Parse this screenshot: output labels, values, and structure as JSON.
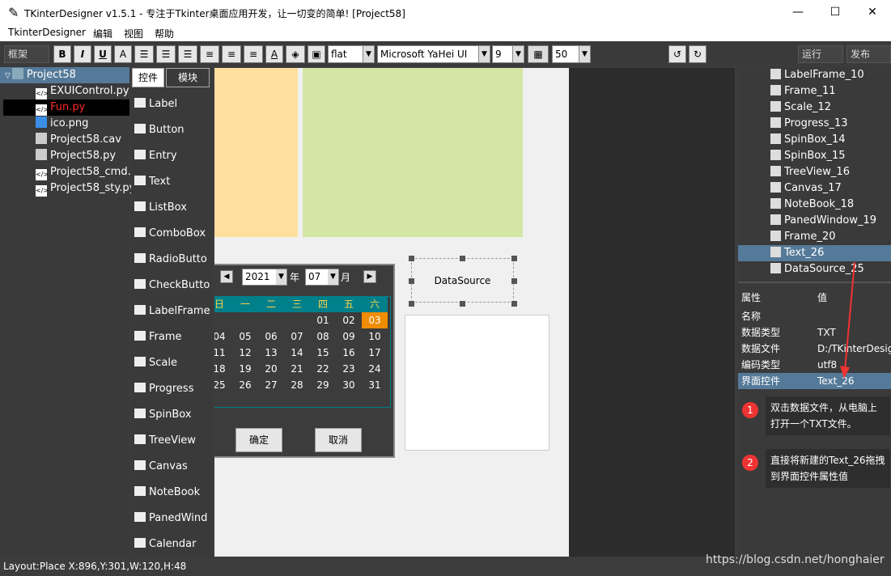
{
  "window": {
    "title": "TKinterDesigner v1.5.1 - 专注于Tkinter桌面应用开发，让一切变的简单!   [Project58]",
    "min": "—",
    "max": "☐",
    "close": "✕"
  },
  "menu": [
    "TkinterDesigner",
    "编辑",
    "视图",
    "帮助"
  ],
  "toolbar": {
    "frame_label": "框架",
    "bold": "B",
    "italic": "I",
    "underline": "U",
    "textA": "A",
    "relief": "flat",
    "font": "Microsoft YaHei UI",
    "size": "9",
    "alpha": "50",
    "run": "运行",
    "publish": "发布"
  },
  "files": [
    {
      "name": "Project58",
      "color": "#ffffff"
    },
    {
      "name": "EXUIControl.py",
      "color": "#ffffff"
    },
    {
      "name": "Fun.py",
      "color": "#ff2a2a"
    },
    {
      "name": "ico.png",
      "color": "#ffffff"
    },
    {
      "name": "Project58.cav",
      "color": "#ffffff"
    },
    {
      "name": "Project58.py",
      "color": "#ffffff"
    },
    {
      "name": "Project58_cmd.py",
      "color": "#ffffff"
    },
    {
      "name": "Project58_sty.py",
      "color": "#ffffff"
    }
  ],
  "palette": {
    "tab_controls": "控件",
    "tab_modules": "模块",
    "items": [
      "Label",
      "Button",
      "Entry",
      "Text",
      "ListBox",
      "ComboBox",
      "RadioButto",
      "CheckButto",
      "LabelFrame",
      "Frame",
      "Scale",
      "Progress",
      "SpinBox",
      "TreeView",
      "Canvas",
      "NoteBook",
      "PanedWind",
      "Calendar"
    ]
  },
  "canvas": {
    "colors": {
      "orange": "#ffdf9e",
      "green": "#d3e6a3"
    },
    "year": "2021",
    "year_label": "年",
    "month": "07",
    "month_label": "月",
    "weekdays": [
      "日",
      "一",
      "二",
      "三",
      "四",
      "五",
      "六"
    ],
    "days": [
      [
        "",
        "",
        "",
        "",
        "01",
        "02",
        "03"
      ],
      [
        "04",
        "05",
        "06",
        "07",
        "08",
        "09",
        "10"
      ],
      [
        "11",
        "12",
        "13",
        "14",
        "15",
        "16",
        "17"
      ],
      [
        "18",
        "19",
        "20",
        "21",
        "22",
        "23",
        "24"
      ],
      [
        "25",
        "26",
        "27",
        "28",
        "29",
        "30",
        "31"
      ]
    ],
    "ok": "确定",
    "cancel": "取消",
    "datasource": "DataSource"
  },
  "controls": [
    "LabelFrame_10",
    "Frame_11",
    "Scale_12",
    "Progress_13",
    "SpinBox_14",
    "SpinBox_15",
    "TreeView_16",
    "Canvas_17",
    "NoteBook_18",
    "PanedWindow_19",
    "Frame_20",
    "Text_26",
    "DataSource_25"
  ],
  "props": {
    "h_attr": "属性",
    "h_value": "值",
    "rows": [
      [
        "名称",
        ""
      ],
      [
        "数据类型",
        "TXT"
      ],
      [
        "数据文件",
        "D:/TKinterDesig"
      ],
      [
        "编码类型",
        "utf8"
      ],
      [
        "界面控件",
        "Text_26"
      ]
    ]
  },
  "annotations": [
    {
      "num": "1",
      "text": "双击数据文件，从电脑上打开一个TXT文件。"
    },
    {
      "num": "2",
      "text": "直接将新建的Text_26拖拽到界面控件属性值"
    }
  ],
  "status": "Layout:Place  X:896,Y:301,W:120,H:48",
  "watermark": "https://blog.csdn.net/honghaier"
}
